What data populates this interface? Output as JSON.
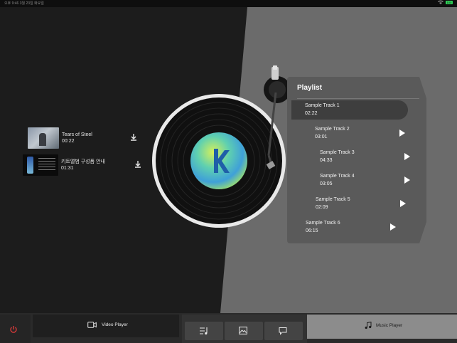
{
  "status_bar": {
    "time": "오후 9:46",
    "date": "3월 23일 화요일",
    "battery": "100"
  },
  "videos": [
    {
      "title": "Tears of Steel",
      "duration": "00:22"
    },
    {
      "title": "키트앨범 구성품 안내",
      "duration": "01:31"
    }
  ],
  "playlist": {
    "title": "Playlist",
    "tracks": [
      {
        "name": "Sample Track 1",
        "duration": "02:22"
      },
      {
        "name": "Sample Track 2",
        "duration": "03:01"
      },
      {
        "name": "Sample Track 3",
        "duration": "04:33"
      },
      {
        "name": "Sample Track 4",
        "duration": "03:05"
      },
      {
        "name": "Sample Track 5",
        "duration": "02:09"
      },
      {
        "name": "Sample Track 6",
        "duration": "06:15"
      }
    ]
  },
  "bottom_bar": {
    "video_player_label": "Video Player",
    "music_player_label": "Music Player"
  },
  "colors": {
    "accent_power": "#e23b3b",
    "panel_dark": "#1c1c1c",
    "panel_light": "#6b6b6b",
    "playlist_bg": "#5a5a5a",
    "active_track": "#3e3e3e"
  },
  "icons": [
    "wifi-icon",
    "battery-icon",
    "download-icon",
    "play-icon",
    "power-icon",
    "video-camera-icon",
    "playlist-icon",
    "image-icon",
    "chat-icon",
    "music-note-icon",
    "vinyl-record",
    "tonearm"
  ]
}
